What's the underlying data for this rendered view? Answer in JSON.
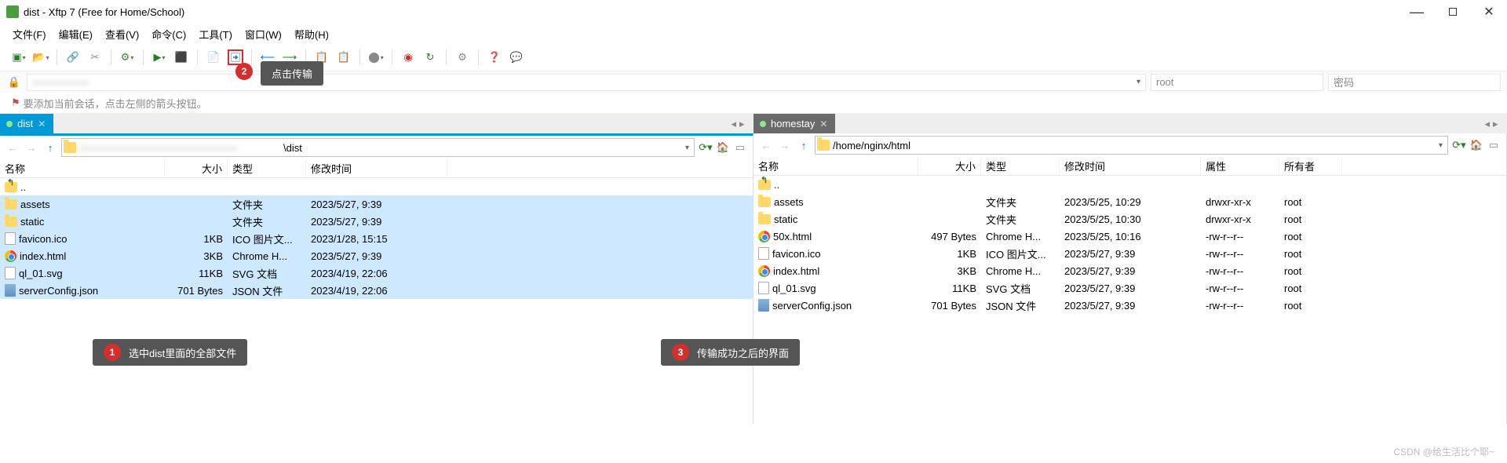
{
  "window": {
    "title": "dist - Xftp 7 (Free for Home/School)"
  },
  "menu": [
    "文件(F)",
    "编辑(E)",
    "查看(V)",
    "命令(C)",
    "工具(T)",
    "窗口(W)",
    "帮助(H)"
  ],
  "session": {
    "user_placeholder": "root",
    "pass_placeholder": "密码"
  },
  "hint_text": "要添加当前会话，点击左侧的箭头按钮。",
  "tabs": {
    "local": "dist",
    "remote": "homestay"
  },
  "local": {
    "path": "\\dist",
    "blurred_prefix": "",
    "columns": {
      "name": "名称",
      "size": "大小",
      "type": "类型",
      "mtime": "修改时间"
    },
    "up": "..",
    "files": [
      {
        "icon": "folder",
        "name": "assets",
        "size": "",
        "type": "文件夹",
        "mtime": "2023/5/27, 9:39"
      },
      {
        "icon": "folder",
        "name": "static",
        "size": "",
        "type": "文件夹",
        "mtime": "2023/5/27, 9:39"
      },
      {
        "icon": "file",
        "name": "favicon.ico",
        "size": "1KB",
        "type": "ICO 图片文...",
        "mtime": "2023/1/28, 15:15"
      },
      {
        "icon": "chrome",
        "name": "index.html",
        "size": "3KB",
        "type": "Chrome H...",
        "mtime": "2023/5/27, 9:39"
      },
      {
        "icon": "file",
        "name": "ql_01.svg",
        "size": "11KB",
        "type": "SVG 文档",
        "mtime": "2023/4/19, 22:06"
      },
      {
        "icon": "json",
        "name": "serverConfig.json",
        "size": "701 Bytes",
        "type": "JSON 文件",
        "mtime": "2023/4/19, 22:06"
      }
    ]
  },
  "remote": {
    "path": "/home/nginx/html",
    "columns": {
      "name": "名称",
      "size": "大小",
      "type": "类型",
      "mtime": "修改时间",
      "attr": "属性",
      "owner": "所有者"
    },
    "up": "..",
    "files": [
      {
        "icon": "folder",
        "name": "assets",
        "size": "",
        "type": "文件夹",
        "mtime": "2023/5/25, 10:29",
        "attr": "drwxr-xr-x",
        "owner": "root"
      },
      {
        "icon": "folder",
        "name": "static",
        "size": "",
        "type": "文件夹",
        "mtime": "2023/5/25, 10:30",
        "attr": "drwxr-xr-x",
        "owner": "root"
      },
      {
        "icon": "chrome",
        "name": "50x.html",
        "size": "497 Bytes",
        "type": "Chrome H...",
        "mtime": "2023/5/25, 10:16",
        "attr": "-rw-r--r--",
        "owner": "root"
      },
      {
        "icon": "file",
        "name": "favicon.ico",
        "size": "1KB",
        "type": "ICO 图片文...",
        "mtime": "2023/5/27, 9:39",
        "attr": "-rw-r--r--",
        "owner": "root"
      },
      {
        "icon": "chrome",
        "name": "index.html",
        "size": "3KB",
        "type": "Chrome H...",
        "mtime": "2023/5/27, 9:39",
        "attr": "-rw-r--r--",
        "owner": "root"
      },
      {
        "icon": "file",
        "name": "ql_01.svg",
        "size": "11KB",
        "type": "SVG 文档",
        "mtime": "2023/5/27, 9:39",
        "attr": "-rw-r--r--",
        "owner": "root"
      },
      {
        "icon": "json",
        "name": "serverConfig.json",
        "size": "701 Bytes",
        "type": "JSON 文件",
        "mtime": "2023/5/27, 9:39",
        "attr": "-rw-r--r--",
        "owner": "root"
      }
    ]
  },
  "callouts": {
    "c1_num": "1",
    "c1_text": "选中dist里面的全部文件",
    "c2_num": "2",
    "c2_text": "点击传输",
    "c3_num": "3",
    "c3_text": "传输成功之后的界面"
  },
  "watermark": "CSDN @给生活比个耶~"
}
